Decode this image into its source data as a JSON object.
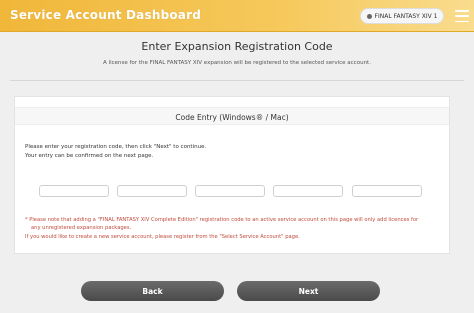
{
  "header": {
    "title": "Service Account Dashboard",
    "account_label": "FINAL FANTASY XIV 1",
    "menu_icon": "hamburger-menu-icon"
  },
  "page": {
    "title": "Enter Expansion Registration Code",
    "subtitle": "A license for the FINAL FANTASY XIV expansion will be registered to the selected service account."
  },
  "panel": {
    "title": "Code Entry (Windows® / Mac)",
    "instruction_line1": "Please enter your registration code, then click \"Next\" to continue.",
    "instruction_line2": "Your entry can be confirmed on the next page.",
    "code_fields": [
      "",
      "",
      "",
      "",
      ""
    ],
    "note_line1": "* Please note that adding a \"FINAL FANTASY XIV Complete Edition\" registration code to an active service account on this page will only add licences for",
    "note_line2": "any unregistered expansion packages.",
    "note_line3": "If you would like to create a new service account, please register from the \"Select Service Account\" page."
  },
  "buttons": {
    "back": "Back",
    "next": "Next"
  },
  "colors": {
    "header_accent": "#f0b73a",
    "note_text": "#c04a3c",
    "button": "#555555"
  }
}
